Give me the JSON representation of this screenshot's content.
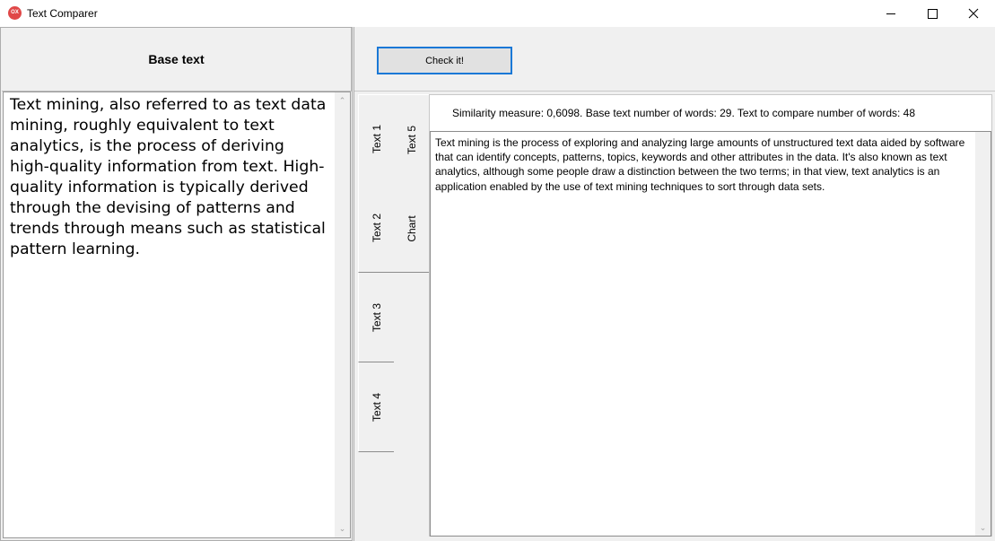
{
  "window": {
    "app_icon_text": "OX",
    "title": "Text Comparer",
    "controls": {
      "minimize": "minimize-icon",
      "maximize": "maximize-icon",
      "close": "close-icon"
    }
  },
  "left_pane": {
    "header": "Base text",
    "text": "Text mining, also referred to as text data mining, roughly equivalent to text analytics, is the process of deriving high-quality information from text. High-quality information is typically derived through the devising of patterns and trends through means such as statistical pattern learning."
  },
  "toolbar": {
    "check_label": "Check it!"
  },
  "tabs": {
    "col1": [
      "Text 1",
      "Text 2",
      "Text 3",
      "Text 4"
    ],
    "col2": [
      "Text 5",
      "Chart"
    ]
  },
  "result": {
    "similarity": "Similarity measure: 0,6098.  Base text number of words: 29.  Text to compare number of words: 48",
    "compare_text": "Text mining is the process of exploring and analyzing large amounts of unstructured text data aided by software that can identify concepts, patterns, topics, keywords and other attributes in the data. It's also known as text analytics, although some people draw a distinction between the two terms; in that view, text analytics is an application enabled by the use of text mining techniques to sort through data sets."
  }
}
